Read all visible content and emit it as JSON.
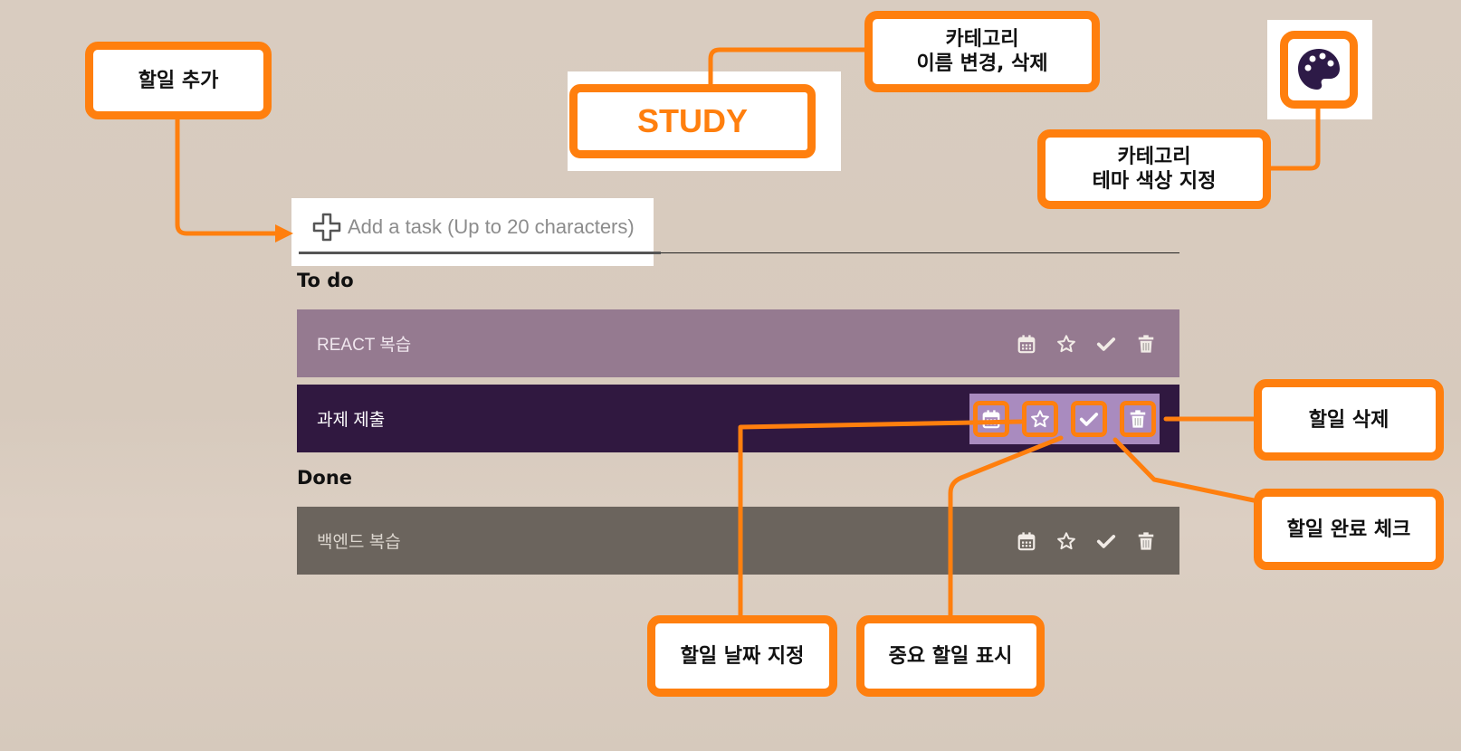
{
  "category": {
    "name": "STUDY"
  },
  "add_task": {
    "placeholder": "Add a task (Up to 20 characters)"
  },
  "sections": {
    "todo": "To do",
    "done": "Done"
  },
  "tasks": {
    "todo": [
      {
        "text": "REACT 복습",
        "bg": "#957a90",
        "text_color": "#f0e6ee",
        "icon_color": "#f1ebe6"
      },
      {
        "text": "과제 제출",
        "bg": "#301840",
        "text_color": "#ffffff",
        "icon_color": "#ffffff"
      }
    ],
    "done": [
      {
        "text": "백엔드 복습",
        "bg": "#6b645d",
        "text_color": "#dcd6cf",
        "icon_color": "#f1ebe6"
      }
    ]
  },
  "callouts": {
    "add_task": "할일 추가",
    "category_edit": "카테고리\n이름 변경, 삭제",
    "theme_color": "카테고리\n테마 색상 지정",
    "delete": "할일 삭제",
    "complete": "할일 완료 체크",
    "date": "할일 날짜 지정",
    "important": "중요 할일 표시"
  },
  "colors": {
    "accent": "#ff7f0e",
    "palette": "#2d1a47",
    "highlight": "#a98bbf"
  },
  "icons": [
    "calendar-icon",
    "star-icon",
    "check-icon",
    "trash-icon",
    "palette-icon",
    "plus-icon"
  ]
}
